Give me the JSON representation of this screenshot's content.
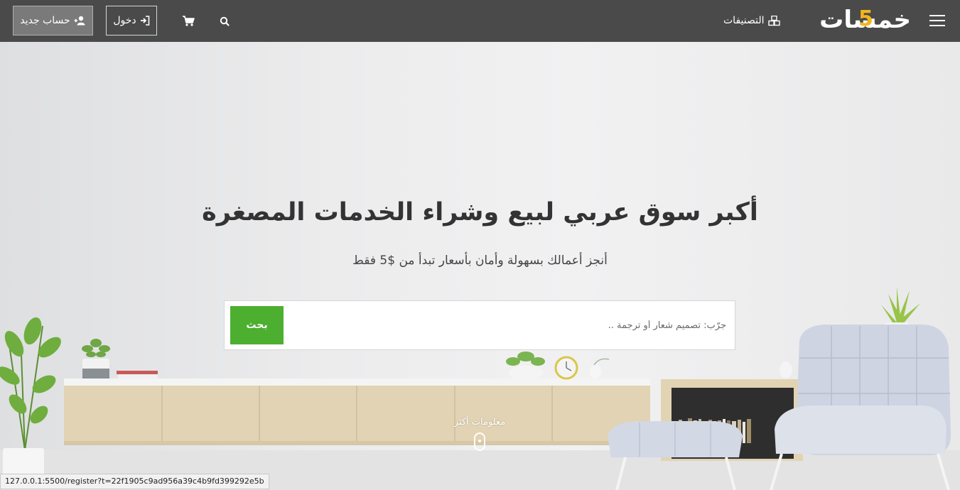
{
  "header": {
    "logo_text": "خمسات",
    "logo_digit": "5",
    "categories_label": "التصنيفات",
    "login_label": "دخول",
    "register_label": "حساب جديد"
  },
  "hero": {
    "title": "أكبر سوق عربي لبيع وشراء الخدمات المصغرة",
    "subtitle": "أنجز أعمالك بسهولة وأمان بأسعار تبدأ من $5 فقط",
    "search_placeholder": "جرّب: تصميم شعار أو ترجمة ..",
    "search_button": "بحث",
    "more_info": "معلومات أكثر"
  },
  "status_bar": {
    "url": "127.0.0.1:5500/register?t=22f1905c9ad956a39c4b9fd399292e5b"
  },
  "colors": {
    "header_bg": "#4a4a4a",
    "accent_green": "#4caf2f",
    "logo_yellow": "#f2b51c"
  },
  "icons": [
    "hamburger-menu-icon",
    "categories-icon",
    "search-icon",
    "cart-icon",
    "sign-in-icon",
    "user-plus-icon",
    "mouse-scroll-icon"
  ]
}
